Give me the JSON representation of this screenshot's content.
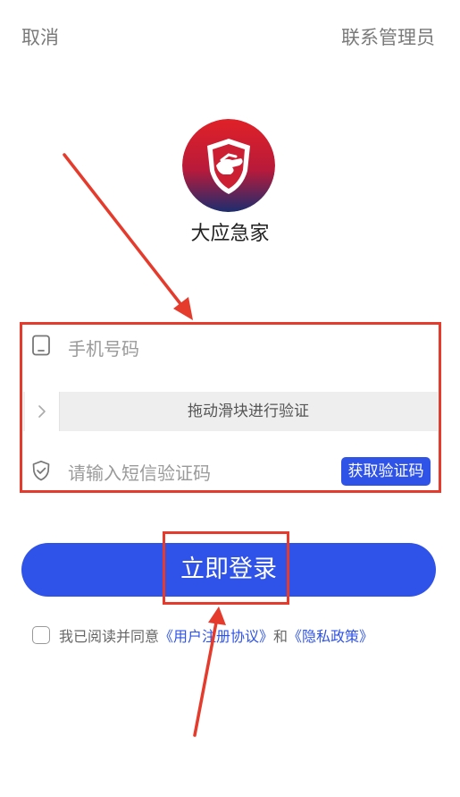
{
  "header": {
    "cancel_label": "取消",
    "contact_admin_label": "联系管理员"
  },
  "app": {
    "name": "大应急家",
    "logo_icon": "handshake-shield-icon"
  },
  "form": {
    "phone_placeholder": "手机号码",
    "slider_text": "拖动滑块进行验证",
    "sms_placeholder": "请输入短信验证码",
    "get_code_label": "获取验证码"
  },
  "login": {
    "button_label": "立即登录"
  },
  "agreement": {
    "prefix": "我已阅读并同意",
    "user_agreement": "《用户注册协议》",
    "and": "和",
    "privacy_policy": "《隐私政策》"
  },
  "colors": {
    "primary": "#2f52e8",
    "annotation": "#e53b2c",
    "logo_red": "#d8202a",
    "logo_navy": "#1d2d6e"
  }
}
